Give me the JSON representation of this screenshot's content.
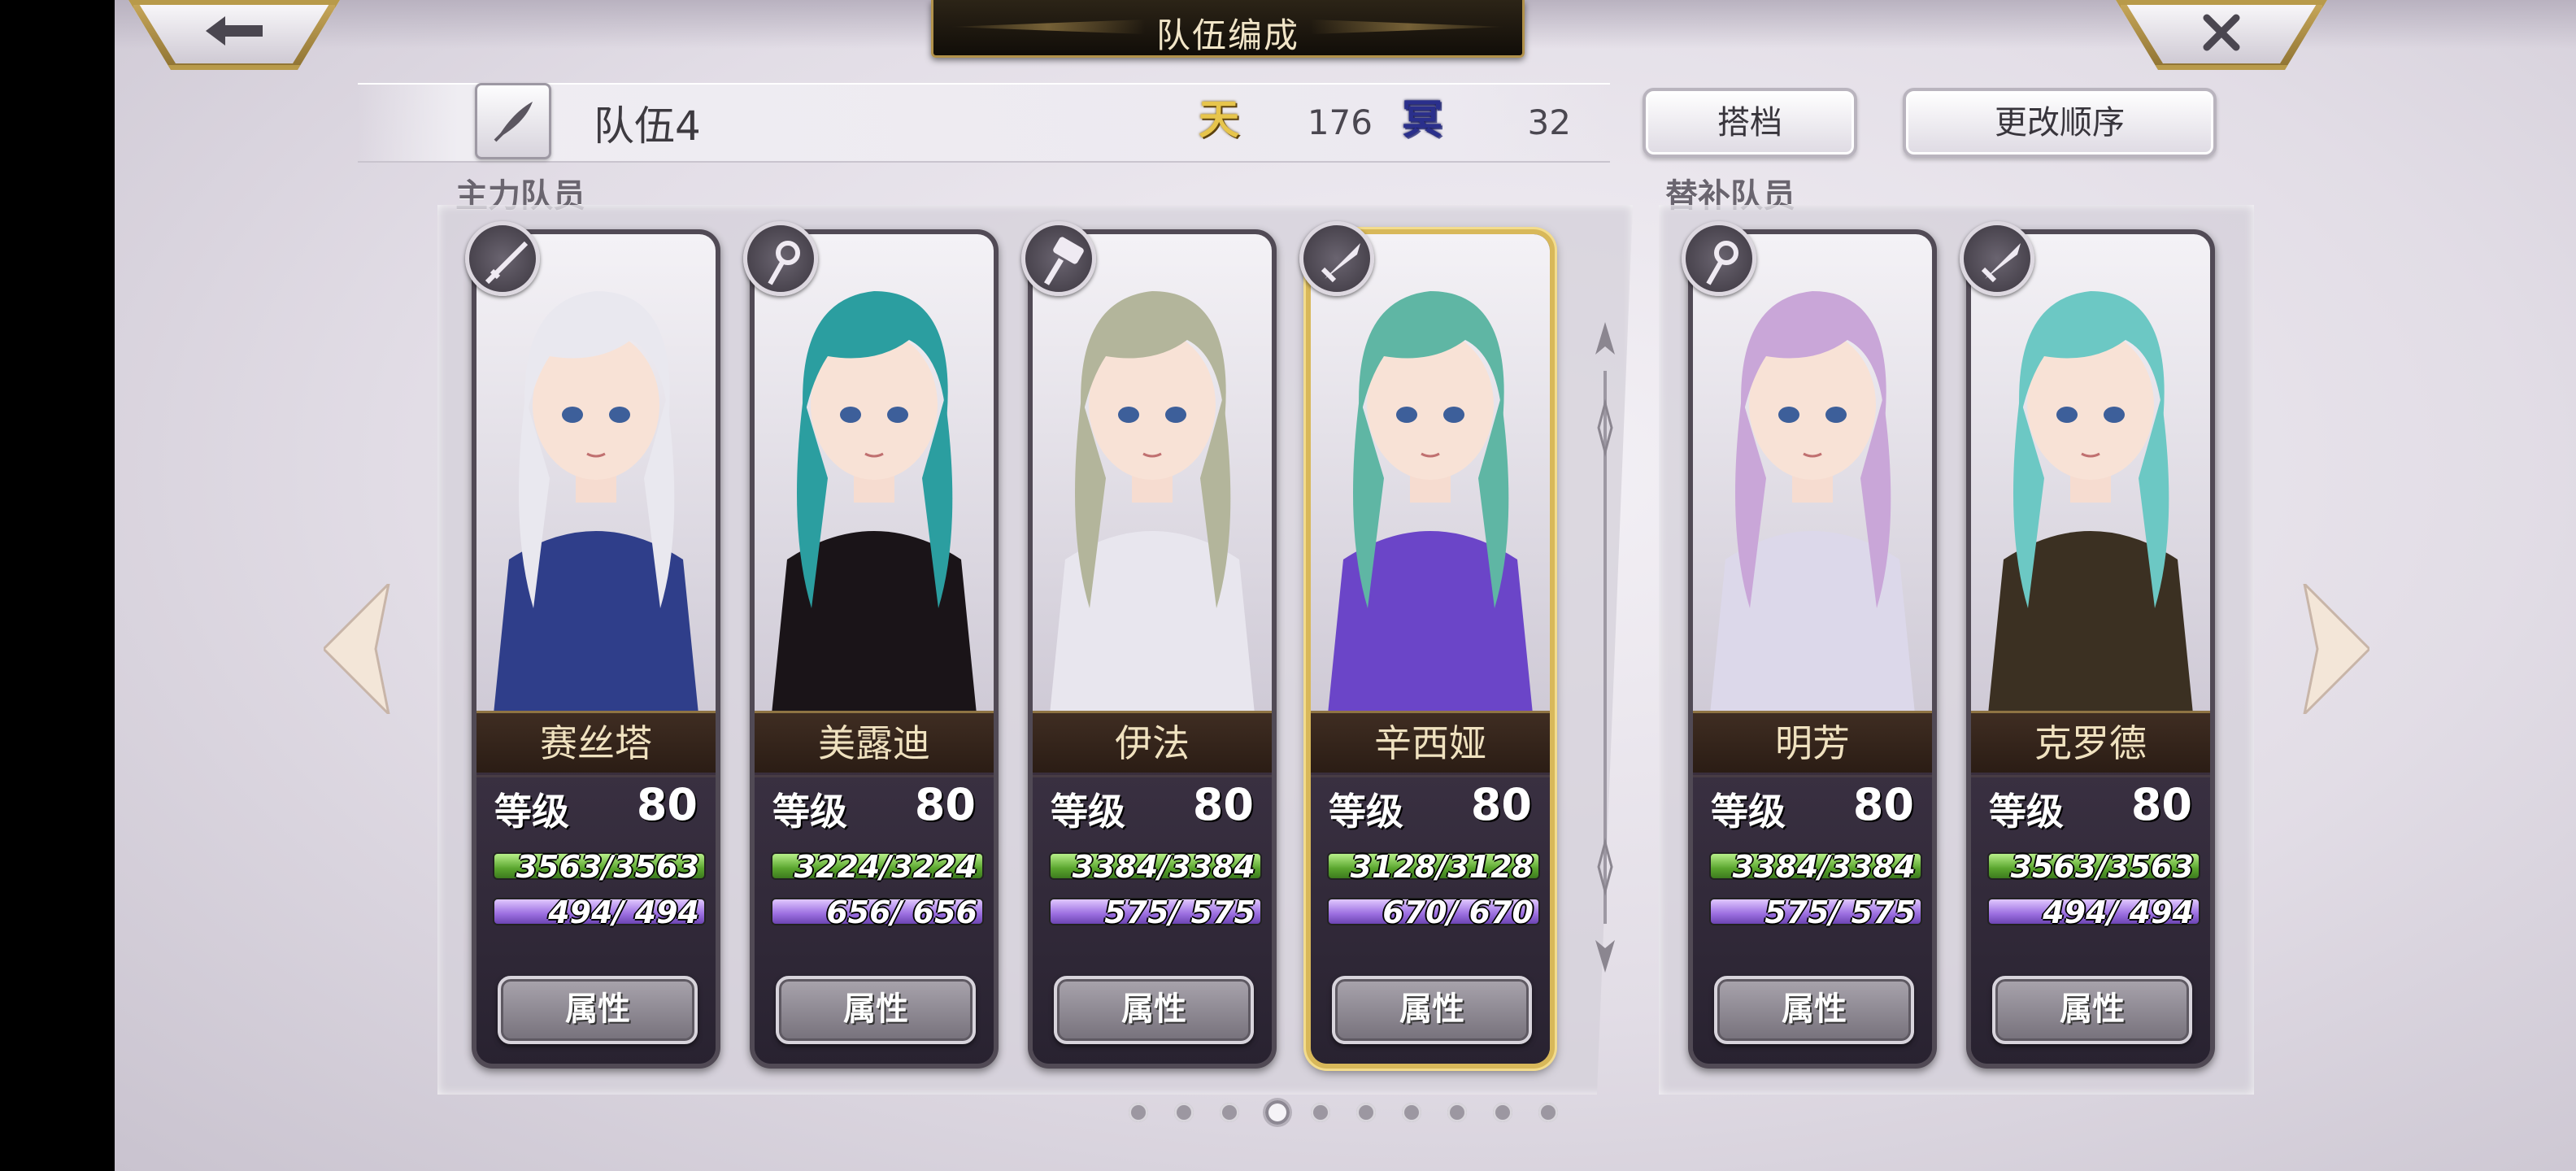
{
  "header": {
    "title": "队伍编成",
    "back_icon": "arrow-left-icon",
    "close_icon": "close-icon"
  },
  "team": {
    "name": "队伍4",
    "heaven_symbol": "天",
    "heaven_value": "176",
    "underworld_symbol": "冥",
    "underworld_value": "32"
  },
  "buttons": {
    "partner": "搭档",
    "reorder": "更改顺序"
  },
  "sections": {
    "main": "主力队员",
    "sub": "替补队员"
  },
  "level_label": "等级",
  "attr_label": "属性",
  "main_members": [
    {
      "name": "赛丝塔",
      "level": "80",
      "hp": "3563/3563",
      "mp": "494/ 494",
      "weapon": "katana-icon",
      "hair": "#e9e8ef",
      "accent": "#2f3e8a",
      "selected": false
    },
    {
      "name": "美露迪",
      "level": "80",
      "hp": "3224/3224",
      "mp": "656/ 656",
      "weapon": "staff-icon",
      "hair": "#2b9ea0",
      "accent": "#1a1418",
      "selected": false
    },
    {
      "name": "伊法",
      "level": "80",
      "hp": "3384/3384",
      "mp": "575/ 575",
      "weapon": "hammer-icon",
      "hair": "#b3b59b",
      "accent": "#e8e6ee",
      "selected": false
    },
    {
      "name": "辛西娅",
      "level": "80",
      "hp": "3128/3128",
      "mp": "670/ 670",
      "weapon": "sword-icon",
      "hair": "#5fb6a4",
      "accent": "#6b45c8",
      "selected": true
    }
  ],
  "sub_members": [
    {
      "name": "明芳",
      "level": "80",
      "hp": "3384/3384",
      "mp": "575/ 575",
      "weapon": "staff-icon",
      "hair": "#c9a6d8",
      "accent": "#dcd8ea",
      "selected": false
    },
    {
      "name": "克罗德",
      "level": "80",
      "hp": "3563/3563",
      "mp": "494/ 494",
      "weapon": "sword-icon",
      "hair": "#6cc8c4",
      "accent": "#3b3022",
      "selected": false
    }
  ],
  "pagination": {
    "total": 10,
    "active": 4
  },
  "colors": {
    "gold": "#d8b85a",
    "hp": "#5aa52e",
    "mp": "#9b6ee0"
  }
}
